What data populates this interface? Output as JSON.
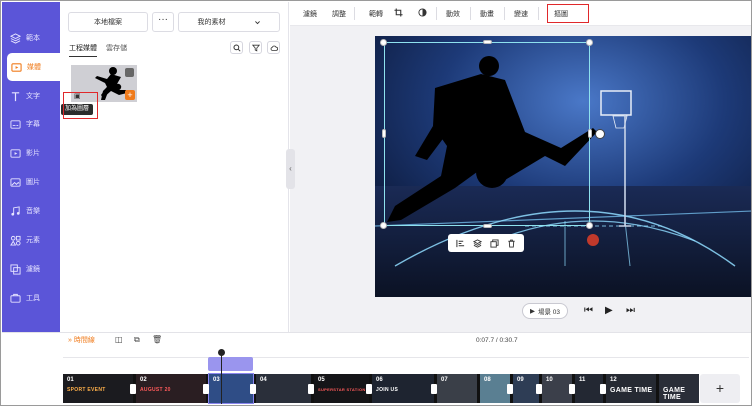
{
  "sidebar": {
    "items": [
      {
        "label": "範本",
        "icon": "template-icon"
      },
      {
        "label": "媒體",
        "icon": "media-icon"
      },
      {
        "label": "文字",
        "icon": "text-icon"
      },
      {
        "label": "字幕",
        "icon": "subtitle-icon"
      },
      {
        "label": "影片",
        "icon": "video-icon"
      },
      {
        "label": "圖片",
        "icon": "image-icon"
      },
      {
        "label": "音樂",
        "icon": "music-icon"
      },
      {
        "label": "元素",
        "icon": "elements-icon"
      },
      {
        "label": "濾鏡",
        "icon": "filter-icon"
      },
      {
        "label": "工具",
        "icon": "tools-icon"
      }
    ],
    "active_index": 1
  },
  "panel": {
    "local_files_label": "本地檔案",
    "more_label": "···",
    "my_assets_label": "我的素材",
    "tabs": [
      "工程媒體",
      "雲存儲"
    ],
    "tooltip": "加為圖層"
  },
  "toolbar": {
    "items": [
      "濾鏡",
      "調整",
      "範轉",
      "動效",
      "動畫",
      "變速",
      "摳圖"
    ]
  },
  "player": {
    "scene_label": "場景 03"
  },
  "timeline": {
    "label": "時間線",
    "time": "0:07.7 / 0:30.7",
    "clips": [
      {
        "num": "01",
        "title": "SPORT EVENT"
      },
      {
        "num": "02",
        "title": "AUGUST 20"
      },
      {
        "num": "03",
        "title": ""
      },
      {
        "num": "04",
        "title": ""
      },
      {
        "num": "05",
        "title": "SUPERSTAR STATION"
      },
      {
        "num": "06",
        "title": "JOIN US"
      },
      {
        "num": "07",
        "title": ""
      },
      {
        "num": "08",
        "title": ""
      },
      {
        "num": "09",
        "title": ""
      },
      {
        "num": "10",
        "title": ""
      },
      {
        "num": "11",
        "title": ""
      },
      {
        "num": "12",
        "title": "GAME TIME"
      },
      {
        "num": "",
        "title": "GAME TIME"
      }
    ],
    "add_label": "+"
  },
  "colors": {
    "sidebar_bg": "#5b55d8",
    "accent_orange": "#f07c1d",
    "highlight_red": "#e0282b",
    "selection_cyan": "#8ee2ee"
  }
}
